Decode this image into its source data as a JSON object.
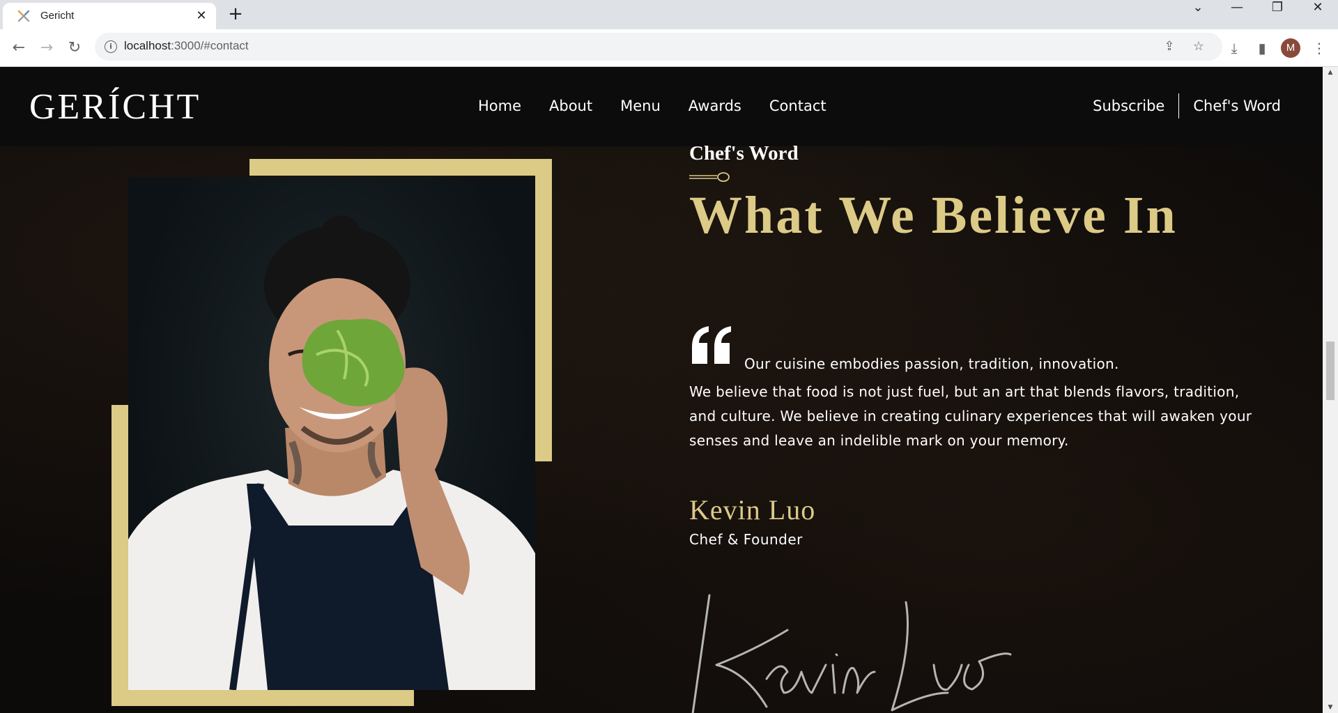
{
  "browser": {
    "tab_title": "Gericht",
    "tab_close": "✕",
    "new_tab": "+",
    "url_host": "localhost",
    "url_rest": ":3000/#contact",
    "profile_initial": "M"
  },
  "navbar": {
    "logo": "GERÍCHT",
    "links": [
      "Home",
      "About",
      "Menu",
      "Awards",
      "Contact"
    ],
    "subscribe": "Subscribe",
    "chefs_word": "Chef's Word"
  },
  "chef": {
    "subtitle": "Chef's Word",
    "heading": "What We Believe In",
    "quote_line1": "Our cuisine embodies passion, tradition, innovation.",
    "quote_body": "We believe that food is not just fuel, but an art that blends flavors, tradition, and culture. We believe in creating culinary experiences that will awaken your senses and leave an indelible mark on your memory.",
    "name": "Kevin Luo",
    "role": "Chef & Founder",
    "signature": "Kevin Luo"
  },
  "colors": {
    "gold": "#dcca87",
    "background": "#0c0c0c",
    "text": "#ffffff"
  },
  "icons": {
    "back": "arrow-left-icon",
    "forward": "arrow-right-icon",
    "reload": "reload-icon",
    "info": "info-icon",
    "share": "share-icon",
    "bookmark": "star-icon",
    "download": "download-icon",
    "sidepanel": "side-panel-icon",
    "menu": "kebab-menu-icon"
  }
}
